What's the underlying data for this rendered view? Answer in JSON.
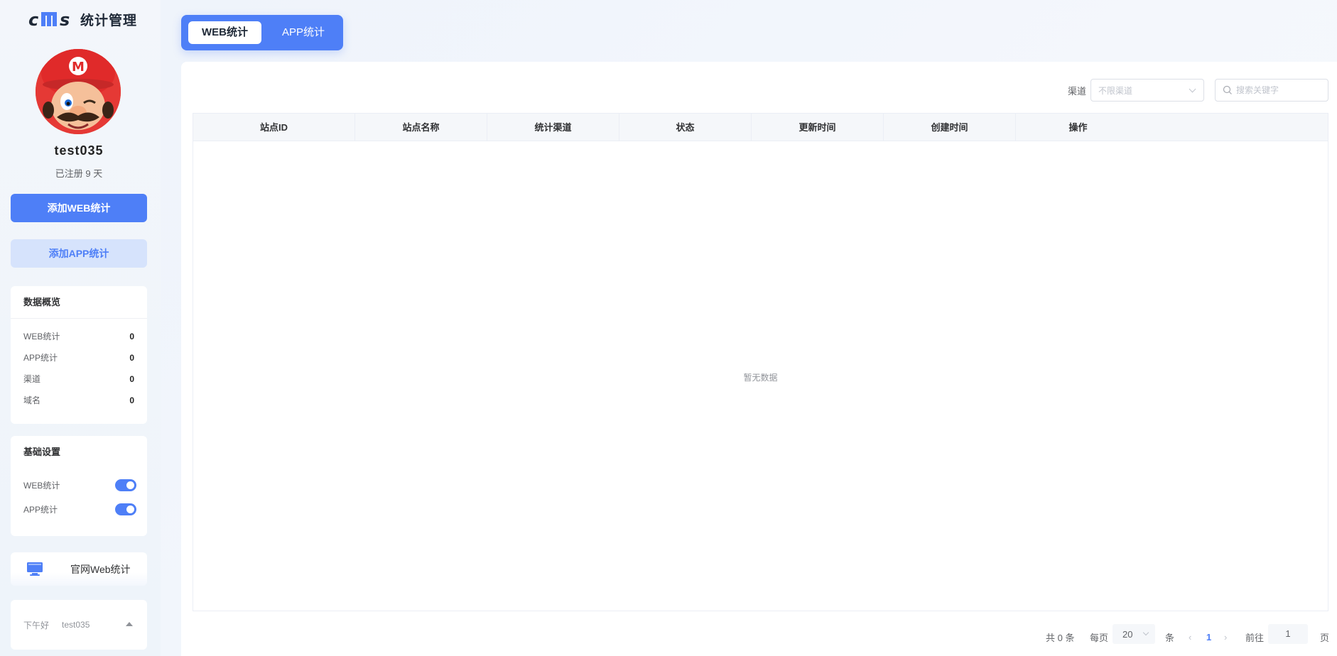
{
  "app": {
    "logo_text": "统计管理"
  },
  "user": {
    "name": "test035",
    "registered": "已注册 9 天"
  },
  "actions": {
    "add_web": "添加WEB统计",
    "add_app": "添加APP统计"
  },
  "overview": {
    "title": "数据概览",
    "items": [
      {
        "label": "WEB统计",
        "value": "0"
      },
      {
        "label": "APP统计",
        "value": "0"
      },
      {
        "label": "渠道",
        "value": "0"
      },
      {
        "label": "域名",
        "value": "0"
      }
    ]
  },
  "settings": {
    "title": "基础设置",
    "items": [
      {
        "label": "WEB统计",
        "enabled": true
      },
      {
        "label": "APP统计",
        "enabled": true
      }
    ]
  },
  "official_link": "官网Web统计",
  "greeting": {
    "text": "下午好",
    "name": "test035"
  },
  "tabs": [
    {
      "label": "WEB统计",
      "active": true
    },
    {
      "label": "APP统计",
      "active": false
    }
  ],
  "filter": {
    "channel_label": "渠道",
    "channel_value": "不限渠道",
    "search_placeholder": "搜索关键字"
  },
  "table": {
    "columns": [
      "站点ID",
      "站点名称",
      "统计渠道",
      "状态",
      "更新时间",
      "创建时间",
      "操作"
    ],
    "empty_text": "暂无数据"
  },
  "pagination": {
    "total": "共 0 条",
    "per_page_label": "每页",
    "page_size": "20",
    "unit": "条",
    "current_page": "1",
    "goto_label": "前往",
    "goto_value": "1",
    "page_suffix": "页"
  },
  "colors": {
    "primary": "#4e7ff7",
    "primary_light": "#d6e3fc"
  }
}
